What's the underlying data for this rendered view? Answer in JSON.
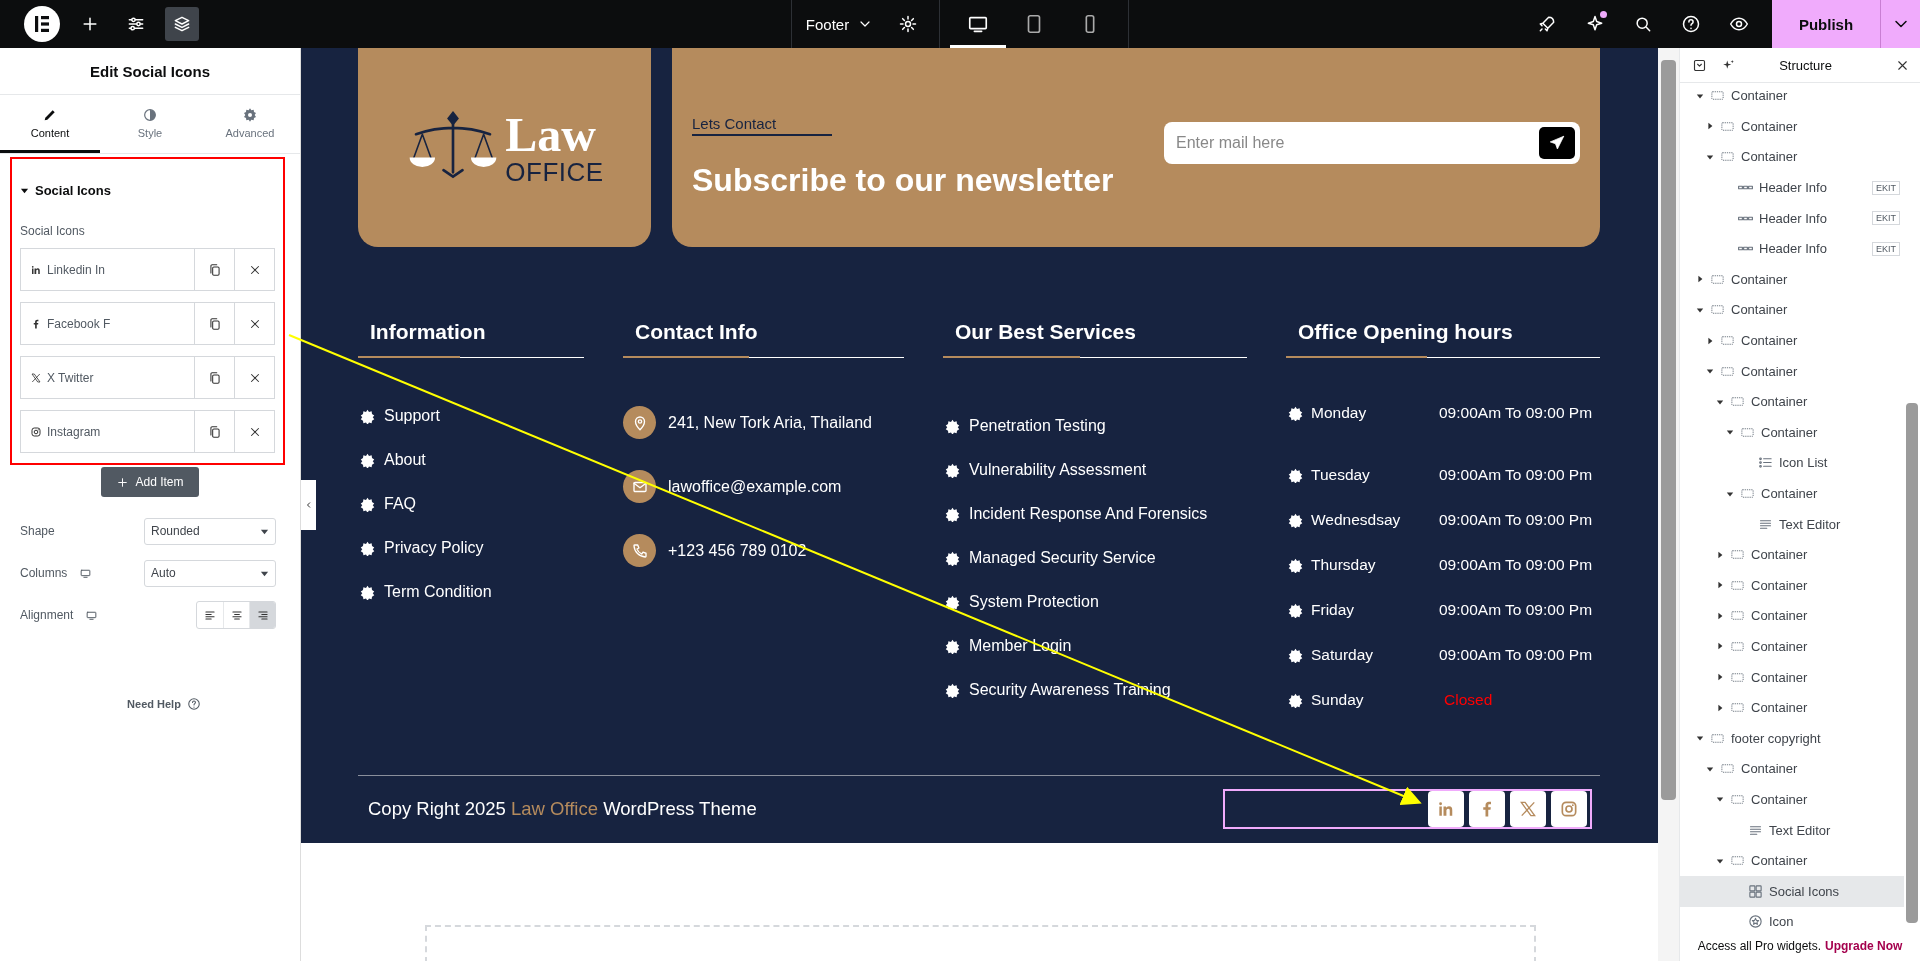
{
  "topbar": {
    "tools": [
      {
        "kind": "add",
        "selected": false
      },
      {
        "kind": "settings",
        "selected": false
      },
      {
        "kind": "layers",
        "selected": true
      }
    ],
    "document": "Footer",
    "devices": [
      {
        "kind": "desktop",
        "selected": true
      },
      {
        "kind": "tablet",
        "selected": false
      },
      {
        "kind": "mobile",
        "selected": false
      }
    ],
    "actions": [
      {
        "kind": "rocket",
        "notification": false
      },
      {
        "kind": "sparkle",
        "notification": true
      },
      {
        "kind": "search",
        "notification": false
      },
      {
        "kind": "help",
        "notification": false
      },
      {
        "kind": "preview",
        "notification": false
      }
    ],
    "publish": "Publish"
  },
  "panel": {
    "title": "Edit Social Icons",
    "tabs": [
      {
        "kind": "content",
        "label": "Content",
        "selected": true
      },
      {
        "kind": "style",
        "label": "Style",
        "selected": false
      },
      {
        "kind": "advanced",
        "label": "Advanced",
        "selected": false
      }
    ],
    "section": {
      "title": "Social Icons",
      "expanded": true,
      "label": "Social Icons",
      "items": [
        {
          "kind": "linkedin",
          "label": "Linkedin In"
        },
        {
          "kind": "facebook",
          "label": "Facebook F"
        },
        {
          "kind": "x",
          "label": "X Twitter"
        },
        {
          "kind": "instagram",
          "label": "Instagram"
        }
      ]
    },
    "add_item": "Add Item",
    "controls": [
      {
        "kind": "select",
        "label": "Shape",
        "value": "Rounded",
        "responsive": false
      },
      {
        "kind": "select",
        "label": "Columns",
        "value": "Auto",
        "responsive": true
      },
      {
        "kind": "align",
        "label": "Alignment",
        "responsive": true,
        "options": [
          {
            "kind": "left",
            "selected": false
          },
          {
            "kind": "center",
            "selected": false
          },
          {
            "kind": "right",
            "selected": true
          }
        ]
      }
    ],
    "help": "Need Help"
  },
  "footer": {
    "logo": {
      "title": "Law",
      "subtitle": "OFFICE"
    },
    "newsletter": {
      "eyebrow": "Lets Contact",
      "title": "Subscribe to our newsletter",
      "placeholder": "Enter mail here"
    },
    "columns": [
      {
        "kind": "links",
        "heading": "Information",
        "items": [
          "Support",
          "About",
          "FAQ",
          "Privacy Policy",
          "Term Condition"
        ]
      },
      {
        "kind": "contact",
        "heading": "Contact Info",
        "items": [
          {
            "kind": "location",
            "text": "241, New Tork Aria, Thailand"
          },
          {
            "kind": "mail",
            "text": "lawoffice@example.com"
          },
          {
            "kind": "phone",
            "text": "+123 456 789 0102"
          }
        ]
      },
      {
        "kind": "links",
        "heading": "Our Best Services",
        "items": [
          "Penetration Testing",
          "Vulnerability Assessment",
          "Incident Response And Forensics",
          "Managed Security Service",
          "System Protection",
          "Member Login",
          "Security Awareness Training"
        ]
      },
      {
        "kind": "hours",
        "heading": "Office Opening hours",
        "items": [
          {
            "day": "Monday",
            "hours": "09:00Am To 09:00 Pm",
            "closed": false
          },
          {
            "day": "Tuesday",
            "hours": "09:00Am To 09:00 Pm",
            "closed": false
          },
          {
            "day": "Wednesdsay",
            "hours": "09:00Am To 09:00 Pm",
            "closed": false
          },
          {
            "day": "Thursday",
            "hours": "09:00Am To 09:00 Pm",
            "closed": false
          },
          {
            "day": "Friday",
            "hours": "09:00Am To 09:00 Pm",
            "closed": false
          },
          {
            "day": "Saturday",
            "hours": "09:00Am To 09:00 Pm",
            "closed": false
          },
          {
            "day": "Sunday",
            "hours": "Closed",
            "closed": true
          }
        ]
      }
    ],
    "copyright": {
      "before": "Copy Right 2025",
      "highlight": "Law Office",
      "after": "WordPress Theme"
    },
    "social": [
      {
        "kind": "linkedin"
      },
      {
        "kind": "facebook"
      },
      {
        "kind": "x"
      },
      {
        "kind": "instagram"
      }
    ]
  },
  "structure": {
    "title": "Structure",
    "items": [
      {
        "kind": "container",
        "label": "Container",
        "expanded": true,
        "selected": false,
        "children": [
          {
            "kind": "container",
            "label": "Container",
            "expanded": false,
            "selected": false
          },
          {
            "kind": "container",
            "label": "Container",
            "expanded": true,
            "selected": false,
            "children": [
              {
                "kind": "header-info",
                "label": "Header Info",
                "badge": "EKIT",
                "selected": false
              },
              {
                "kind": "header-info",
                "label": "Header Info",
                "badge": "EKIT",
                "selected": false
              },
              {
                "kind": "header-info",
                "label": "Header Info",
                "badge": "EKIT",
                "selected": false
              }
            ]
          }
        ]
      },
      {
        "kind": "container",
        "label": "Container",
        "expanded": false,
        "selected": false
      },
      {
        "kind": "container",
        "label": "Container",
        "expanded": true,
        "selected": false,
        "children": [
          {
            "kind": "container",
            "label": "Container",
            "expanded": false,
            "selected": false
          },
          {
            "kind": "container",
            "label": "Container",
            "expanded": true,
            "selected": false,
            "children": [
              {
                "kind": "container",
                "label": "Container",
                "expanded": true,
                "selected": false,
                "children": [
                  {
                    "kind": "container",
                    "label": "Container",
                    "expanded": true,
                    "selected": false,
                    "children": [
                      {
                        "kind": "icon-list",
                        "label": "Icon List",
                        "selected": false
                      }
                    ]
                  },
                  {
                    "kind": "container",
                    "label": "Container",
                    "expanded": true,
                    "selected": false,
                    "children": [
                      {
                        "kind": "text-editor",
                        "label": "Text Editor",
                        "selected": false
                      }
                    ]
                  }
                ]
              },
              {
                "kind": "container",
                "label": "Container",
                "expanded": false,
                "selected": false
              },
              {
                "kind": "container",
                "label": "Container",
                "expanded": false,
                "selected": false
              },
              {
                "kind": "container",
                "label": "Container",
                "expanded": false,
                "selected": false
              },
              {
                "kind": "container",
                "label": "Container",
                "expanded": false,
                "selected": false
              },
              {
                "kind": "container",
                "label": "Container",
                "expanded": false,
                "selected": false
              },
              {
                "kind": "container",
                "label": "Container",
                "expanded": false,
                "selected": false
              }
            ]
          }
        ]
      },
      {
        "kind": "container",
        "label": "footer copyright",
        "expanded": true,
        "selected": false,
        "children": [
          {
            "kind": "container",
            "label": "Container",
            "expanded": true,
            "selected": false,
            "children": [
              {
                "kind": "container",
                "label": "Container",
                "expanded": true,
                "selected": false,
                "children": [
                  {
                    "kind": "text-editor",
                    "label": "Text Editor",
                    "selected": false
                  }
                ]
              },
              {
                "kind": "container",
                "label": "Container",
                "expanded": true,
                "selected": false,
                "children": [
                  {
                    "kind": "social-icons",
                    "label": "Social Icons",
                    "selected": true
                  },
                  {
                    "kind": "icon",
                    "label": "Icon",
                    "selected": false
                  }
                ]
              }
            ]
          }
        ]
      }
    ],
    "promo": "Access all Pro widgets.",
    "upgrade": "Upgrade Now"
  }
}
